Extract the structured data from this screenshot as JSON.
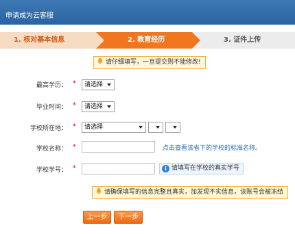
{
  "window": {
    "title": "申请成为云客服"
  },
  "steps": [
    {
      "label": "1. 核对基本信息"
    },
    {
      "label": "2. 教育经历"
    },
    {
      "label": "3. 证件上传"
    }
  ],
  "notice_top": "请仔细填写，一旦提交则不能修改!",
  "form": {
    "required_mark": "*",
    "education": {
      "label": "最高学历：",
      "value": "请选择"
    },
    "graduation": {
      "label": "毕业时间：",
      "value": "请选择"
    },
    "location": {
      "label": "学校所在地：",
      "province": "请选择",
      "city": "",
      "district": ""
    },
    "school_name": {
      "label": "学校名称：",
      "value": "",
      "hint": "点击查看该省下的学校的标准名称。"
    },
    "student_id": {
      "label": "学校学号：",
      "value": "",
      "info": "请填写在学校的真实学号"
    }
  },
  "notice_bottom": "请确保填写的信息完整且真实，加发现不实信息，该账号会被冻结",
  "buttons": {
    "prev": "上一步",
    "next": "下一步"
  },
  "colors": {
    "accent": "#f0761f",
    "titlebar": "#2a63a0",
    "link": "#2f6db6",
    "required": "#ee3333"
  }
}
